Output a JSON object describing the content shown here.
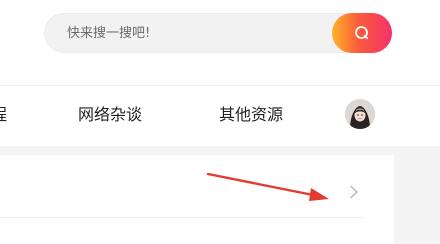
{
  "search": {
    "placeholder": "快来搜一搜吧!",
    "button_icon": "search-icon"
  },
  "nav": {
    "items": [
      {
        "label": "程"
      },
      {
        "label": "网络杂谈"
      },
      {
        "label": "其他资源"
      }
    ],
    "avatar_icon": "user-avatar"
  },
  "content": {
    "row_icon": "chevron-right-icon",
    "annotation_icon": "red-arrow-annotation"
  },
  "colors": {
    "search_gradient_start": "#ffb22b",
    "search_gradient_mid": "#fb5a3b",
    "search_gradient_end": "#f4306a",
    "annotation_red": "#e53a2f"
  }
}
